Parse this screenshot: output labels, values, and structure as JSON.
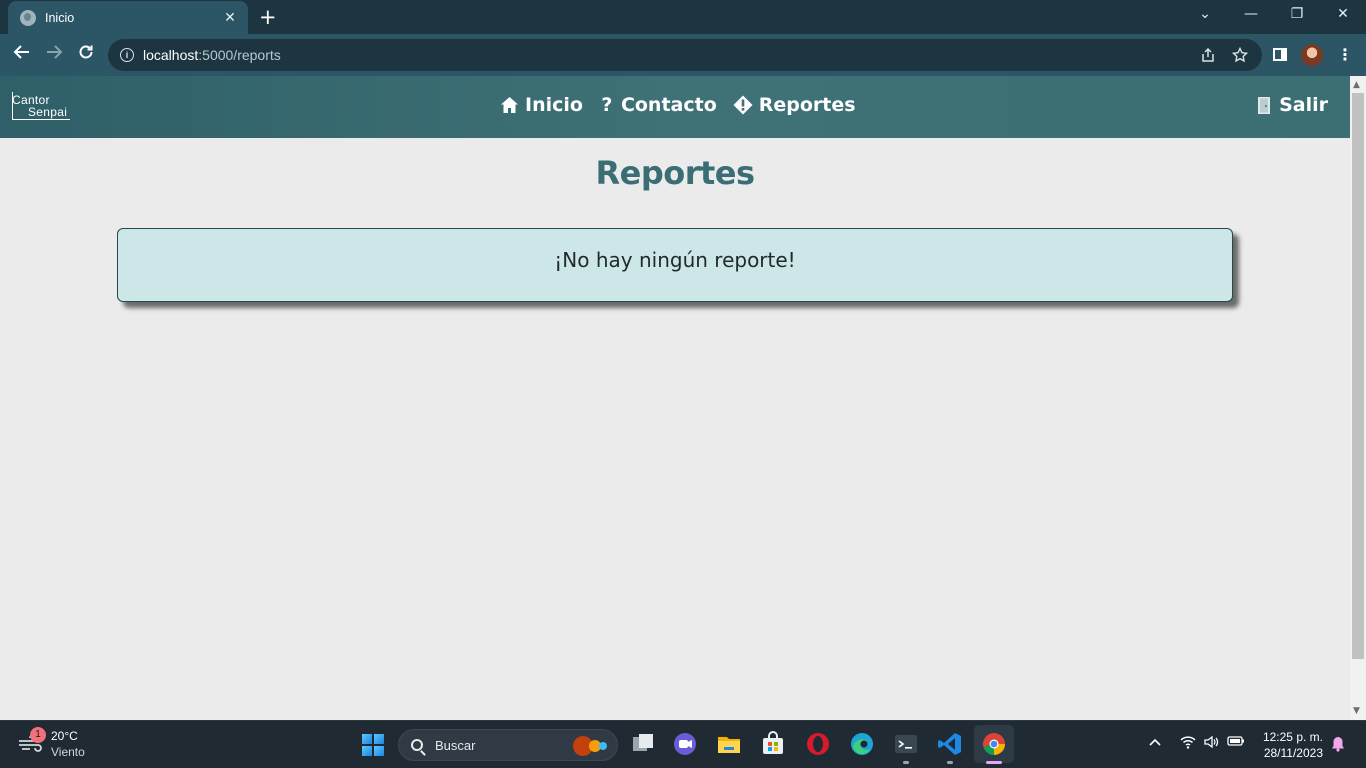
{
  "browser": {
    "tab_title": "Inicio",
    "tab_close": "✕",
    "new_tab": "+",
    "url_host": "localhost",
    "url_path": ":5000/reports",
    "window_controls": {
      "minimize": "—",
      "maximize": "❐",
      "close": "✕",
      "tab_search": "⌄"
    }
  },
  "navbar": {
    "logo_line1": "Cantor",
    "logo_line2": "Senpai",
    "menu": [
      {
        "label": "Inicio",
        "icon": "home-icon"
      },
      {
        "label": "Contacto",
        "icon": "question-icon"
      },
      {
        "label": "Reportes",
        "icon": "warning-diamond-icon"
      }
    ],
    "logout_label": "Salir",
    "logout_icon": "door-icon"
  },
  "main": {
    "title": "Reportes",
    "empty_message": "¡No hay ningún reporte!"
  },
  "taskbar": {
    "weather_temp": "20°C",
    "weather_desc": "Viento",
    "weather_badge": "1",
    "search_placeholder": "Buscar",
    "clock_time": "12:25 p. m.",
    "clock_date": "28/11/2023"
  },
  "colors": {
    "navbar": "#3e7276",
    "title": "#3a6e74",
    "box_bg": "#cde6e8",
    "chrome_dark": "#1c3540",
    "chrome_tab": "#2c5566"
  }
}
